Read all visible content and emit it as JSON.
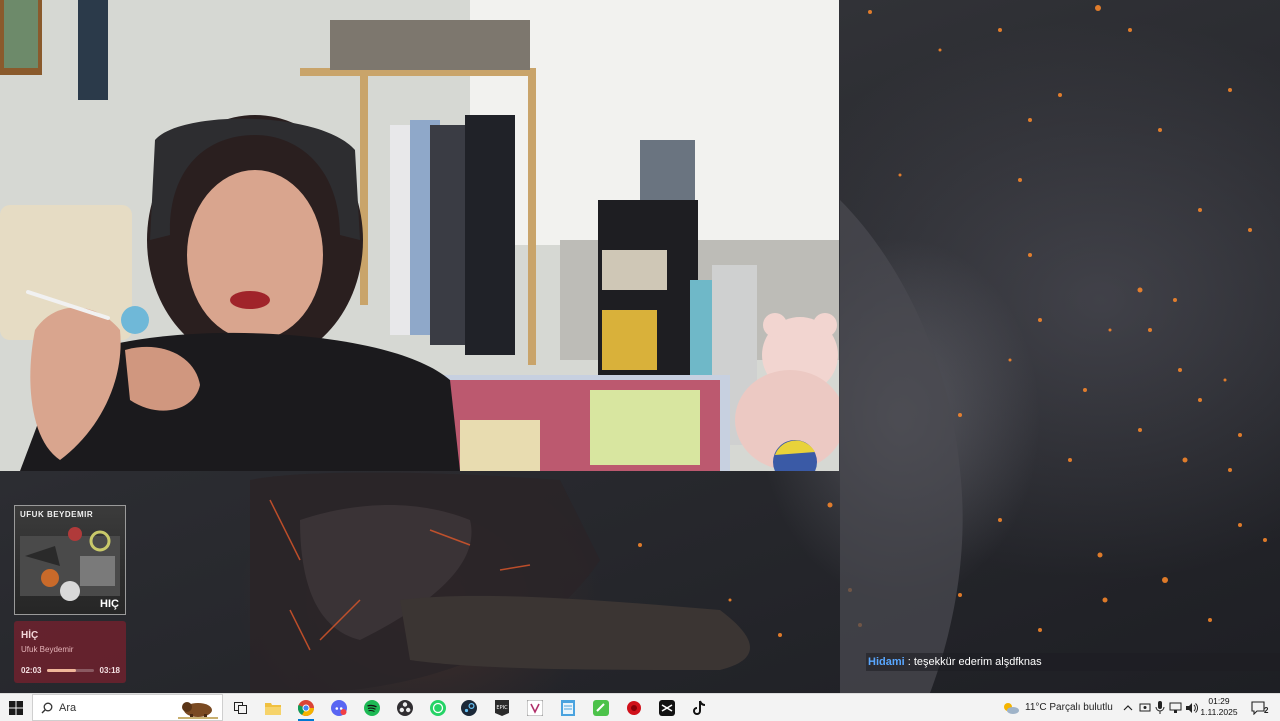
{
  "music_widget": {
    "album_artist": "UFUK BEYDEMIR",
    "album_title": "HIÇ",
    "song_title": "HİÇ",
    "song_artist": "Ufuk Beydemir",
    "elapsed": "02:03",
    "duration": "03:18",
    "progress_fraction": 0.62,
    "accent": "#f0b69a"
  },
  "chat": {
    "username": "Hidami",
    "separator": " : ",
    "message": "teşekkür ederim alşdfknas"
  },
  "taskbar": {
    "search_placeholder": "Ara",
    "weather": "11°C  Parçalı bulutlu",
    "time": "01:29",
    "date": "1.11.2025",
    "notification_count": "2",
    "apps": [
      {
        "name": "task-view-icon"
      },
      {
        "name": "file-explorer-icon"
      },
      {
        "name": "chrome-icon"
      },
      {
        "name": "discord-icon"
      },
      {
        "name": "spotify-icon"
      },
      {
        "name": "obs-icon"
      },
      {
        "name": "whatsapp-icon"
      },
      {
        "name": "steam-icon"
      },
      {
        "name": "epic-games-icon"
      },
      {
        "name": "vegas-icon"
      },
      {
        "name": "notepad-icon"
      },
      {
        "name": "green-app-icon"
      },
      {
        "name": "red-app-icon"
      },
      {
        "name": "capcut-icon"
      },
      {
        "name": "tiktok-icon"
      }
    ]
  }
}
